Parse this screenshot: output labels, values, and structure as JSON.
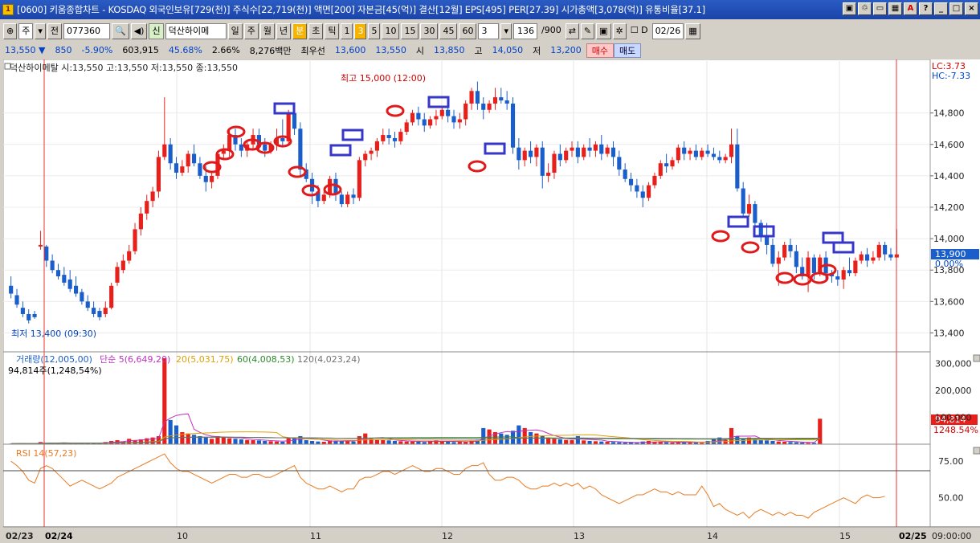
{
  "title_bar": {
    "text": "[0600] 키움종합차트 - KOSDAQ 외국인보유[729(천)] 주식수[22,719(천)] 액면[200] 자본금[45(억)] 결산[12월] EPS[495] PER[27.39] 시가총액[3,078(억)] 유통비율[37.1]",
    "app_icon": "1",
    "buttons": [
      "▣",
      "♲",
      "▭",
      "▦",
      "A",
      "?",
      "_",
      "□",
      "×"
    ]
  },
  "toolbar": {
    "period": "주",
    "type": "전",
    "code": "077360",
    "stock_name": "덕산하이메",
    "credit_tag": "신",
    "periods": [
      "일",
      "주",
      "월",
      "년",
      "분",
      "초",
      "틱"
    ],
    "active_period": "분",
    "minutes": [
      "1",
      "3",
      "5",
      "10",
      "15",
      "30",
      "45",
      "60"
    ],
    "active_minute": "3",
    "interval_value": "3",
    "count": "136",
    "count_total": "/900",
    "date": "02/26",
    "checkbox_label": "D"
  },
  "quote_bar": {
    "price": "13,550",
    "arrow": "▼",
    "change": "850",
    "change_pct": "-5.90%",
    "volume": "603,915",
    "vol_ratio": "45.68%",
    "turnover": "2.66%",
    "amount": "8,276백만",
    "priority_label": "최우선",
    "ask": "13,600",
    "bid": "13,550",
    "open_label": "시",
    "open": "13,850",
    "high_label": "고",
    "high": "14,050",
    "low_label": "저",
    "low": "13,200",
    "buy_label": "매수",
    "sell_label": "매도"
  },
  "chart_legend": {
    "price": "덕산하이메탈 시:13,550 고:13,550 저:13,550 종:13,550",
    "volume": [
      "거래량(12,005,00)",
      "단순 5(6,649,20)",
      "20(5,031,75)",
      "60(4,008,53)",
      "120(4,023,24)"
    ],
    "volume_sub": "94,814주(1,248,54%)",
    "rsi": "RSI 14(57,23)"
  },
  "annotations": {
    "high": "최고 15,000 (12:00)",
    "low": "최저 13,400 (09:30)",
    "lc": "LC:3.73",
    "hc": "HC:-7.33",
    "price_tag": "13,900",
    "price_tag_pct": "0.00%",
    "vol_tag": "94,814",
    "vol_tag_pct": "1248.54%"
  },
  "price_axis": [
    "14,800",
    "14,600",
    "14,400",
    "14,200",
    "14,000",
    "13,800",
    "13,600",
    "13,400"
  ],
  "volume_axis": [
    "300,000",
    "200,000",
    "100,000"
  ],
  "rsi_axis": [
    "75.00",
    "50.00"
  ],
  "time_axis": [
    "02/23",
    "02/24",
    "10",
    "11",
    "12",
    "13",
    "14",
    "15",
    "02/25",
    "09:00:00"
  ],
  "colors": {
    "up": "#e8201c",
    "down": "#1a5ecc",
    "ma5": "#c030c0",
    "ma20": "#e0a000",
    "ma60": "#2a8a2a",
    "ma120": "#707070",
    "rsi": "#e87a20"
  },
  "chart_data": {
    "type": "candlestick",
    "x_session_labels": [
      "02/24",
      "10",
      "11",
      "12",
      "13",
      "14",
      "15",
      "02/25"
    ],
    "price_range": [
      13300,
      15100
    ],
    "volume_range": [
      0,
      320000
    ],
    "rsi_range": [
      30,
      85
    ],
    "rsi_levels": [
      70,
      30
    ],
    "candles": [
      [
        13700,
        13760,
        13650,
        13620
      ],
      [
        13640,
        13680,
        13580,
        13560
      ],
      [
        13560,
        13600,
        13520,
        13500
      ],
      [
        13520,
        13550,
        13480,
        13460
      ],
      [
        13520,
        13540,
        13500,
        13490
      ],
      [
        13950,
        14050,
        13960,
        13930
      ],
      [
        13950,
        13960,
        13860,
        13820
      ],
      [
        13860,
        13900,
        13800,
        13780
      ],
      [
        13800,
        13840,
        13760,
        13740
      ],
      [
        13770,
        13820,
        13720,
        13700
      ],
      [
        13740,
        13800,
        13680,
        13660
      ],
      [
        13700,
        13760,
        13650,
        13630
      ],
      [
        13660,
        13680,
        13600,
        13580
      ],
      [
        13600,
        13640,
        13560,
        13540
      ],
      [
        13560,
        13600,
        13520,
        13500
      ],
      [
        13540,
        13560,
        13500,
        13480
      ],
      [
        13520,
        13600,
        13560,
        13500
      ],
      [
        13560,
        13720,
        13700,
        13550
      ],
      [
        13720,
        13850,
        13820,
        13700
      ],
      [
        13800,
        13900,
        13860,
        13780
      ],
      [
        13860,
        13960,
        13920,
        13840
      ],
      [
        13920,
        14100,
        14060,
        13900
      ],
      [
        14060,
        14200,
        14160,
        14020
      ],
      [
        14160,
        14280,
        14240,
        14120
      ],
      [
        14240,
        14330,
        14300,
        14200
      ],
      [
        14300,
        14560,
        14520,
        14260
      ],
      [
        14520,
        14900,
        14600,
        14500
      ],
      [
        14600,
        14640,
        14480,
        14440
      ],
      [
        14480,
        14520,
        14420,
        14380
      ],
      [
        14420,
        14500,
        14460,
        14400
      ],
      [
        14460,
        14560,
        14540,
        14420
      ],
      [
        14540,
        14600,
        14480,
        14460
      ],
      [
        14480,
        14520,
        14400,
        14380
      ],
      [
        14400,
        14460,
        14360,
        14300
      ],
      [
        14360,
        14420,
        14400,
        14320
      ],
      [
        14400,
        14560,
        14540,
        14380
      ],
      [
        14540,
        14600,
        14560,
        14500
      ],
      [
        14560,
        14700,
        14660,
        14520
      ],
      [
        14660,
        14700,
        14600,
        14560
      ],
      [
        14600,
        14640,
        14560,
        14520
      ],
      [
        14560,
        14620,
        14600,
        14520
      ],
      [
        14600,
        14700,
        14660,
        14560
      ],
      [
        14660,
        14700,
        14600,
        14560
      ],
      [
        14600,
        14640,
        14560,
        14520
      ],
      [
        14560,
        14620,
        14600,
        14540
      ],
      [
        14600,
        14700,
        14640,
        14560
      ],
      [
        14640,
        14760,
        14620,
        14580
      ],
      [
        14620,
        14820,
        14800,
        14600
      ],
      [
        14800,
        14860,
        14700,
        14660
      ],
      [
        14700,
        14740,
        14440,
        14400
      ],
      [
        14440,
        14480,
        14380,
        14360
      ],
      [
        14380,
        14420,
        14300,
        14220
      ],
      [
        14300,
        14340,
        14240,
        14200
      ],
      [
        14240,
        14300,
        14280,
        14220
      ],
      [
        14280,
        14400,
        14380,
        14260
      ],
      [
        14380,
        14420,
        14280,
        14240
      ],
      [
        14280,
        14300,
        14220,
        14200
      ],
      [
        14220,
        14300,
        14280,
        14200
      ],
      [
        14280,
        14320,
        14260,
        14220
      ],
      [
        14260,
        14520,
        14500,
        14240
      ],
      [
        14500,
        14560,
        14540,
        14460
      ],
      [
        14540,
        14580,
        14560,
        14500
      ],
      [
        14560,
        14640,
        14620,
        14520
      ],
      [
        14620,
        14700,
        14660,
        14600
      ],
      [
        14660,
        14700,
        14640,
        14600
      ],
      [
        14640,
        14680,
        14620,
        14580
      ],
      [
        14620,
        14700,
        14680,
        14600
      ],
      [
        14680,
        14760,
        14740,
        14660
      ],
      [
        14740,
        14820,
        14800,
        14720
      ],
      [
        14800,
        14840,
        14760,
        14720
      ],
      [
        14760,
        14800,
        14720,
        14680
      ],
      [
        14720,
        14780,
        14760,
        14700
      ],
      [
        14760,
        14820,
        14780,
        14720
      ],
      [
        14780,
        14840,
        14820,
        14760
      ],
      [
        14820,
        14860,
        14780,
        14740
      ],
      [
        14780,
        14820,
        14740,
        14700
      ],
      [
        14740,
        14800,
        14760,
        14700
      ],
      [
        14760,
        14880,
        14860,
        14720
      ],
      [
        14860,
        14960,
        14940,
        14820
      ],
      [
        14940,
        15000,
        14860,
        14820
      ],
      [
        14860,
        14900,
        14820,
        14760
      ],
      [
        14820,
        14880,
        14860,
        14800
      ],
      [
        14860,
        14960,
        14900,
        14820
      ],
      [
        14900,
        14960,
        14880,
        14860
      ],
      [
        14880,
        14940,
        14860,
        14820
      ],
      [
        14860,
        14900,
        14580,
        14540
      ],
      [
        14580,
        14640,
        14500,
        14440
      ],
      [
        14500,
        14580,
        14560,
        14460
      ],
      [
        14560,
        14620,
        14520,
        14480
      ],
      [
        14520,
        14600,
        14580,
        14460
      ],
      [
        14580,
        14620,
        14400,
        14320
      ],
      [
        14400,
        14480,
        14420,
        14360
      ],
      [
        14420,
        14560,
        14540,
        14380
      ],
      [
        14540,
        14600,
        14500,
        14460
      ],
      [
        14500,
        14580,
        14560,
        14480
      ],
      [
        14560,
        14620,
        14580,
        14520
      ],
      [
        14580,
        14620,
        14520,
        14480
      ],
      [
        14520,
        14600,
        14580,
        14500
      ],
      [
        14580,
        14640,
        14560,
        14520
      ],
      [
        14560,
        14620,
        14600,
        14520
      ],
      [
        14600,
        14660,
        14540,
        14500
      ],
      [
        14540,
        14600,
        14580,
        14520
      ],
      [
        14580,
        14620,
        14520,
        14460
      ],
      [
        14520,
        14560,
        14440,
        14400
      ],
      [
        14440,
        14480,
        14380,
        14360
      ],
      [
        14380,
        14420,
        14340,
        14300
      ],
      [
        14340,
        14380,
        14300,
        14260
      ],
      [
        14300,
        14340,
        14260,
        14200
      ],
      [
        14260,
        14360,
        14340,
        14240
      ],
      [
        14340,
        14420,
        14400,
        14320
      ],
      [
        14400,
        14500,
        14480,
        14380
      ],
      [
        14480,
        14540,
        14460,
        14420
      ],
      [
        14460,
        14520,
        14500,
        14440
      ],
      [
        14500,
        14600,
        14580,
        14480
      ],
      [
        14580,
        14620,
        14540,
        14500
      ],
      [
        14540,
        14580,
        14560,
        14500
      ],
      [
        14560,
        14600,
        14520,
        14500
      ],
      [
        14520,
        14580,
        14560,
        14500
      ],
      [
        14560,
        14600,
        14540,
        14520
      ],
      [
        14540,
        14580,
        14520,
        14500
      ],
      [
        14520,
        14560,
        14500,
        14480
      ],
      [
        14500,
        14540,
        14520,
        14480
      ],
      [
        14520,
        14700,
        14600,
        14480
      ],
      [
        14600,
        14700,
        14320,
        14300
      ],
      [
        14320,
        14360,
        14160,
        14140
      ],
      [
        14160,
        14280,
        14220,
        14140
      ],
      [
        14220,
        14240,
        14100,
        14060
      ],
      [
        14100,
        14120,
        14020,
        13980
      ],
      [
        14020,
        14100,
        13960,
        13900
      ],
      [
        13960,
        14000,
        13840,
        13820
      ],
      [
        13840,
        13920,
        13880,
        13700
      ],
      [
        13880,
        13980,
        13960,
        13860
      ],
      [
        13960,
        14000,
        13920,
        13880
      ],
      [
        13920,
        13960,
        13820,
        13780
      ],
      [
        13820,
        13880,
        13760,
        13740
      ],
      [
        13760,
        13920,
        13880,
        13660
      ],
      [
        13880,
        13900,
        13780,
        13740
      ],
      [
        13780,
        13900,
        13880,
        13760
      ],
      [
        13880,
        13920,
        13780,
        13740
      ],
      [
        13780,
        13800,
        13760,
        13720
      ],
      [
        13760,
        13800,
        13740,
        13700
      ],
      [
        13740,
        13820,
        13800,
        13680
      ],
      [
        13800,
        13880,
        13780,
        13760
      ],
      [
        13780,
        13880,
        13860,
        13760
      ],
      [
        13860,
        13920,
        13900,
        13840
      ],
      [
        13900,
        13940,
        13860,
        13820
      ],
      [
        13860,
        13920,
        13880,
        13840
      ],
      [
        13880,
        13980,
        13960,
        13860
      ],
      [
        13960,
        13980,
        13900,
        13860
      ],
      [
        13900,
        13940,
        13880,
        13860
      ],
      [
        13880,
        14060,
        13900,
        13880
      ]
    ],
    "volumes": [
      2000,
      2500,
      3000,
      2000,
      1500,
      8000,
      4000,
      6000,
      3000,
      5000,
      4000,
      3000,
      6000,
      5000,
      4000,
      3000,
      8000,
      12000,
      15000,
      10000,
      20000,
      14000,
      18000,
      22000,
      25000,
      30000,
      320000,
      90000,
      70000,
      45000,
      40000,
      35000,
      30000,
      25000,
      20000,
      30000,
      28000,
      22000,
      20000,
      18000,
      16000,
      15000,
      14000,
      12000,
      11000,
      10000,
      9000,
      22000,
      25000,
      30000,
      15000,
      12000,
      10000,
      9000,
      14000,
      13000,
      12000,
      11000,
      10000,
      30000,
      40000,
      20000,
      18000,
      15000,
      14000,
      12000,
      11000,
      10000,
      10000,
      9000,
      8000,
      12000,
      14000,
      10000,
      9000,
      8000,
      9000,
      10000,
      12000,
      16000,
      60000,
      55000,
      45000,
      40000,
      35000,
      50000,
      70000,
      60000,
      45000,
      40000,
      30000,
      25000,
      20000,
      18000,
      16000,
      15000,
      30000,
      14000,
      12000,
      11000,
      10000,
      9000,
      8000,
      7000,
      6000,
      6000,
      5000,
      10000,
      12000,
      9000,
      8000,
      7000,
      6000,
      8000,
      9000,
      7000,
      6000,
      5000,
      12000,
      20000,
      25000,
      15000,
      60000,
      30000,
      20000,
      25000,
      18000,
      15000,
      14000,
      12000,
      10000,
      9000,
      8000,
      7000,
      6000,
      5000,
      5000,
      94814
    ],
    "rsi": [
      75,
      72,
      68,
      62,
      60,
      70,
      72,
      70,
      66,
      62,
      58,
      60,
      62,
      60,
      58,
      56,
      58,
      60,
      64,
      66,
      68,
      70,
      72,
      74,
      76,
      78,
      80,
      74,
      70,
      68,
      68,
      66,
      64,
      62,
      60,
      62,
      64,
      66,
      66,
      64,
      64,
      66,
      66,
      64,
      64,
      66,
      68,
      70,
      72,
      64,
      60,
      58,
      56,
      56,
      58,
      56,
      54,
      56,
      56,
      62,
      64,
      64,
      66,
      68,
      68,
      66,
      68,
      70,
      72,
      70,
      68,
      68,
      70,
      70,
      68,
      66,
      66,
      70,
      72,
      72,
      74,
      66,
      62,
      62,
      64,
      64,
      62,
      58,
      56,
      56,
      58,
      58,
      60,
      58,
      60,
      58,
      60,
      56,
      58,
      56,
      52,
      50,
      48,
      46,
      48,
      50,
      52,
      52,
      54,
      56,
      54,
      54,
      52,
      54,
      52,
      52,
      52,
      58,
      52,
      44,
      46,
      42,
      40,
      38,
      40,
      36,
      40,
      42,
      40,
      38,
      40,
      38,
      40,
      38,
      38,
      36,
      40,
      42,
      44,
      46,
      48,
      50,
      48,
      46,
      50,
      52,
      50,
      50,
      51
    ]
  }
}
